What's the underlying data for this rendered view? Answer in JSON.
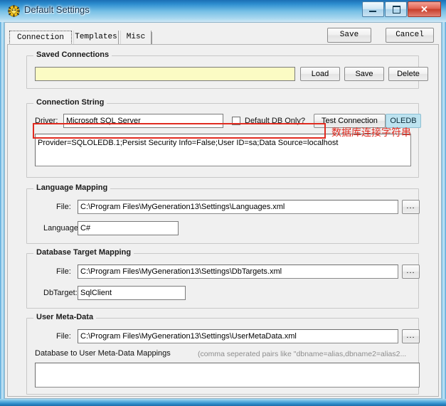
{
  "window": {
    "title": "Default Settings",
    "icon": "app-gear-icon",
    "controls": {
      "minimize": "minimize-icon",
      "maximize": "maximize-icon",
      "close": "✕"
    }
  },
  "toolbar": {
    "save_label": "Save",
    "cancel_label": "Cancel"
  },
  "tabs": [
    {
      "label": "Connection",
      "active": true
    },
    {
      "label": "Templates",
      "active": false
    },
    {
      "label": "Misc",
      "active": false
    }
  ],
  "saved_connections": {
    "title": "Saved Connections",
    "combo_value": "",
    "buttons": {
      "load": "Load",
      "save": "Save",
      "delete": "Delete"
    }
  },
  "connection_string": {
    "title": "Connection String",
    "driver_label": "Driver:",
    "driver_value": "Microsoft SQL Server",
    "default_db_label": "Default DB Only?",
    "default_db_checked": false,
    "test_connection_label": "Test Connection",
    "oledb_label": "OLEDB",
    "oledb_color": "#bde3f0",
    "value": "Provider=SQLOLEDB.1;Persist Security Info=False;User ID=sa;Data Source=localhost"
  },
  "annotation": {
    "text": "数据库连接字符串",
    "color": "#e02b20"
  },
  "language_mapping": {
    "title": "Language Mapping",
    "file_label": "File:",
    "file_value": "C:\\Program Files\\MyGeneration13\\Settings\\Languages.xml",
    "browse_label": "...",
    "language_label": "Language:",
    "language_value": "C#"
  },
  "database_target_mapping": {
    "title": "Database Target Mapping",
    "file_label": "File:",
    "file_value": "C:\\Program Files\\MyGeneration13\\Settings\\DbTargets.xml",
    "browse_label": "...",
    "dbtarget_label": "DbTarget:",
    "dbtarget_value": "SqlClient"
  },
  "user_meta_data": {
    "title": "User Meta-Data",
    "file_label": "File:",
    "file_value": "C:\\Program Files\\MyGeneration13\\Settings\\UserMetaData.xml",
    "browse_label": "...",
    "mappings_label": "Database to User Meta-Data Mappings",
    "mappings_hint": "(comma seperated pairs like \"dbname=alias,dbname2=alias2...",
    "mappings_value": ""
  }
}
